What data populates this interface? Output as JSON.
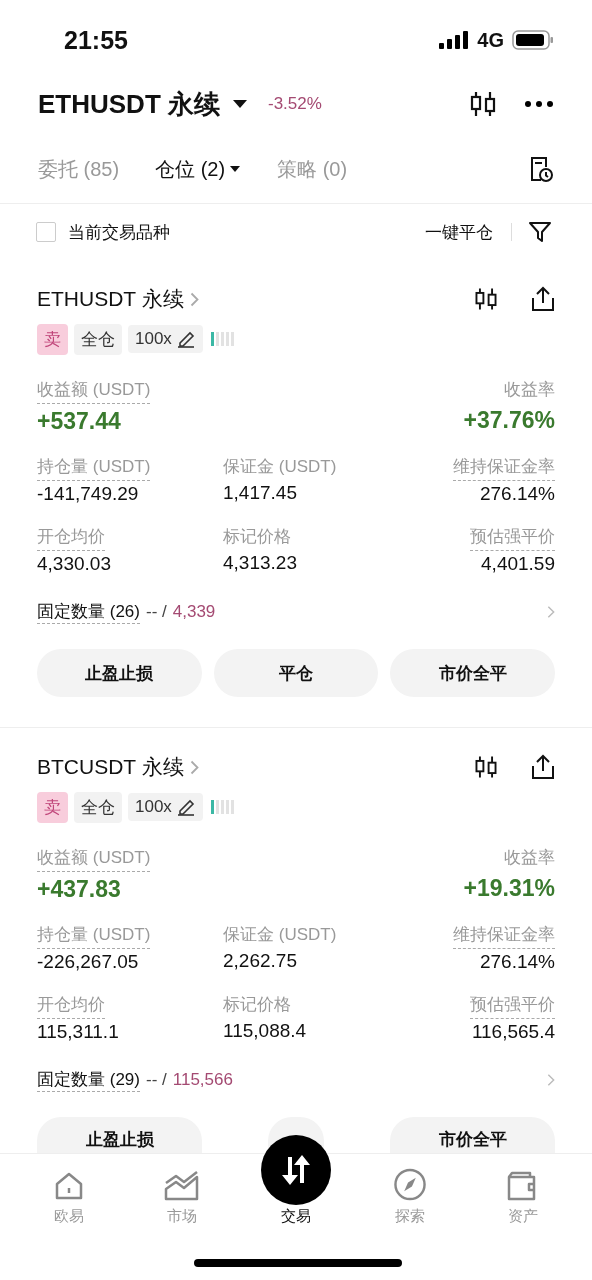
{
  "status_bar": {
    "time": "21:55",
    "network": "4G"
  },
  "header": {
    "symbol": "ETHUSDT 永续",
    "change": "-3.52%"
  },
  "tabs": [
    {
      "label": "委托 (85)",
      "selected": false,
      "dropdown": false
    },
    {
      "label": "仓位 (2)",
      "selected": true,
      "dropdown": true
    },
    {
      "label": "策略 (0)",
      "selected": false,
      "dropdown": false
    }
  ],
  "filter": {
    "label": "当前交易品种",
    "checked": false,
    "action": "一键平仓"
  },
  "positions": [
    {
      "symbol": "ETHUSDT 永续",
      "side": "卖",
      "margin_mode": "全仓",
      "leverage": "100x",
      "level": 0.2,
      "pnl_label": "收益额 (USDT)",
      "pnl": "+537.44",
      "roe_label": "收益率",
      "roe": "+37.76%",
      "fields": [
        {
          "label": "持仓量 (USDT)",
          "value": "-141,749.29",
          "dashed": true
        },
        {
          "label": "保证金 (USDT)",
          "value": "1,417.45",
          "dashed": false
        },
        {
          "label": "维持保证金率",
          "value": "276.14%",
          "dashed": true
        },
        {
          "label": "开仓均价",
          "value": "4,330.03",
          "dashed": true
        },
        {
          "label": "标记价格",
          "value": "4,313.23",
          "dashed": false
        },
        {
          "label": "预估强平价",
          "value": "4,401.59",
          "dashed": true
        }
      ],
      "fixed_label": "固定数量 (26)",
      "tpsl": "-- /",
      "order_price": "4,339",
      "buttons": [
        {
          "kind": "text",
          "label": "止盈止损"
        },
        {
          "kind": "text",
          "label": "平仓"
        },
        {
          "kind": "text",
          "label": "市价全平"
        }
      ]
    },
    {
      "symbol": "BTCUSDT 永续",
      "side": "卖",
      "margin_mode": "全仓",
      "leverage": "100x",
      "level": 0.2,
      "pnl_label": "收益额 (USDT)",
      "pnl": "+437.83",
      "roe_label": "收益率",
      "roe": "+19.31%",
      "fields": [
        {
          "label": "持仓量 (USDT)",
          "value": "-226,267.05",
          "dashed": true
        },
        {
          "label": "保证金 (USDT)",
          "value": "2,262.75",
          "dashed": false
        },
        {
          "label": "维持保证金率",
          "value": "276.14%",
          "dashed": true
        },
        {
          "label": "开仓均价",
          "value": "115,311.1",
          "dashed": true
        },
        {
          "label": "标记价格",
          "value": "115,088.4",
          "dashed": false
        },
        {
          "label": "预估强平价",
          "value": "116,565.4",
          "dashed": true
        }
      ],
      "fixed_label": "固定数量 (29)",
      "tpsl": "-- /",
      "order_price": "115,566",
      "buttons": [
        {
          "kind": "text",
          "label": "止盈止损"
        },
        {
          "kind": "covered"
        },
        {
          "kind": "text",
          "label": "市价全平"
        }
      ]
    }
  ],
  "nav": [
    {
      "label": "欧易",
      "kind": "home",
      "selected": false
    },
    {
      "label": "市场",
      "kind": "chart",
      "selected": false
    },
    {
      "label": "交易",
      "kind": "trade",
      "selected": true
    },
    {
      "label": "探索",
      "kind": "compass",
      "selected": false
    },
    {
      "label": "资产",
      "kind": "wallet",
      "selected": false
    }
  ]
}
